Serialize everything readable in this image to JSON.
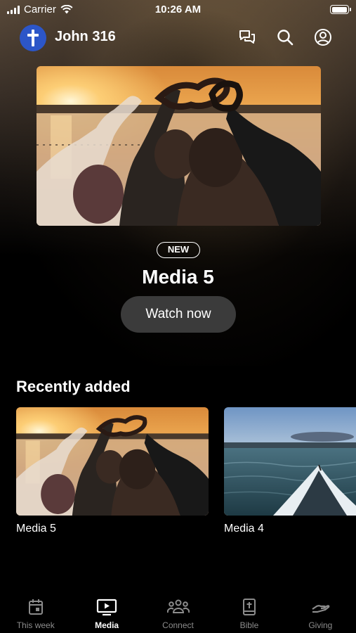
{
  "status_bar": {
    "carrier": "Carrier",
    "time": "10:26 AM"
  },
  "header": {
    "title": "John 316",
    "icons": [
      "cross-icon",
      "messages-icon",
      "search-icon",
      "profile-icon"
    ]
  },
  "hero": {
    "badge": "NEW",
    "title": "Media 5",
    "button_label": "Watch now"
  },
  "recently_added": {
    "title": "Recently added",
    "items": [
      {
        "label": "Media 5"
      },
      {
        "label": "Media 4"
      }
    ]
  },
  "tab_bar": {
    "tabs": [
      {
        "label": "This week",
        "icon": "calendar-icon"
      },
      {
        "label": "Media",
        "icon": "tv-play-icon",
        "active": true
      },
      {
        "label": "Connect",
        "icon": "group-icon"
      },
      {
        "label": "Bible",
        "icon": "bible-icon"
      },
      {
        "label": "Giving",
        "icon": "giving-hand-icon"
      }
    ]
  },
  "colors": {
    "accent": "#2c56c8",
    "button_bg": "#3b3b3b",
    "tab_inactive": "#8c8c8c"
  }
}
